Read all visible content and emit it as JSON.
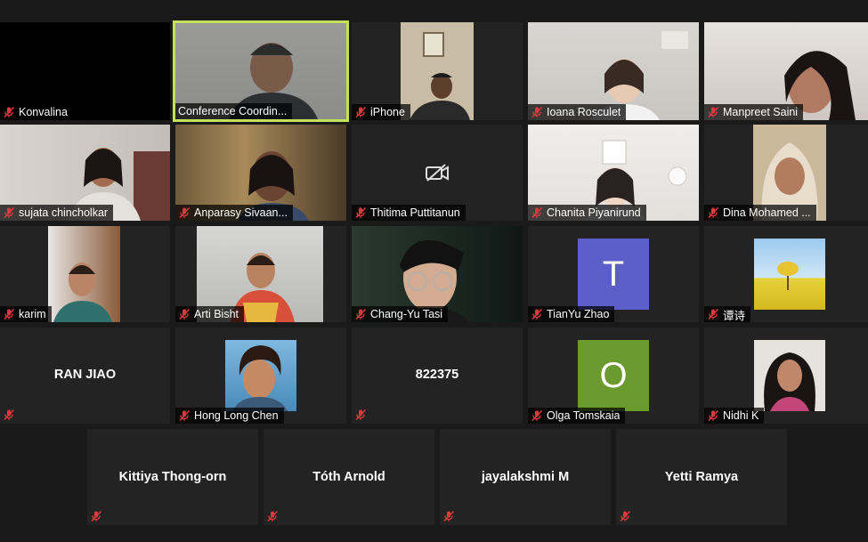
{
  "participants": [
    {
      "name": "Konvalina"
    },
    {
      "name": "Conference Coordin..."
    },
    {
      "name": "iPhone"
    },
    {
      "name": "Ioana Rosculet"
    },
    {
      "name": "Manpreet Saini"
    },
    {
      "name": "sujata chincholkar"
    },
    {
      "name": "Anparasy Sivaan..."
    },
    {
      "name": "Thitima Puttitanun"
    },
    {
      "name": "Chanita Piyanirund"
    },
    {
      "name": "Dina Mohamed ..."
    },
    {
      "name": "karim"
    },
    {
      "name": "Arti Bisht"
    },
    {
      "name": "Chang-Yu Tasi"
    },
    {
      "name": "TianYu Zhao",
      "initial": "T",
      "color": "#5b5fc7"
    },
    {
      "name": "谭诗"
    },
    {
      "name": "RAN JIAO"
    },
    {
      "name": "Hong Long Chen"
    },
    {
      "name": "822375"
    },
    {
      "name": "Olga Tomskaia",
      "initial": "O",
      "color": "#6b9a2e"
    },
    {
      "name": "Nidhi K"
    },
    {
      "name": "Kittiya Thong-orn"
    },
    {
      "name": "Tóth Arnold"
    },
    {
      "name": "jayalakshmi M"
    },
    {
      "name": "Yetti Ramya"
    }
  ],
  "colors": {
    "active_speaker_border": "#c5e05a",
    "muted_icon": "#e0383e"
  },
  "icons": {
    "muted": "mic-off-icon",
    "camera_off": "camera-off-icon"
  }
}
